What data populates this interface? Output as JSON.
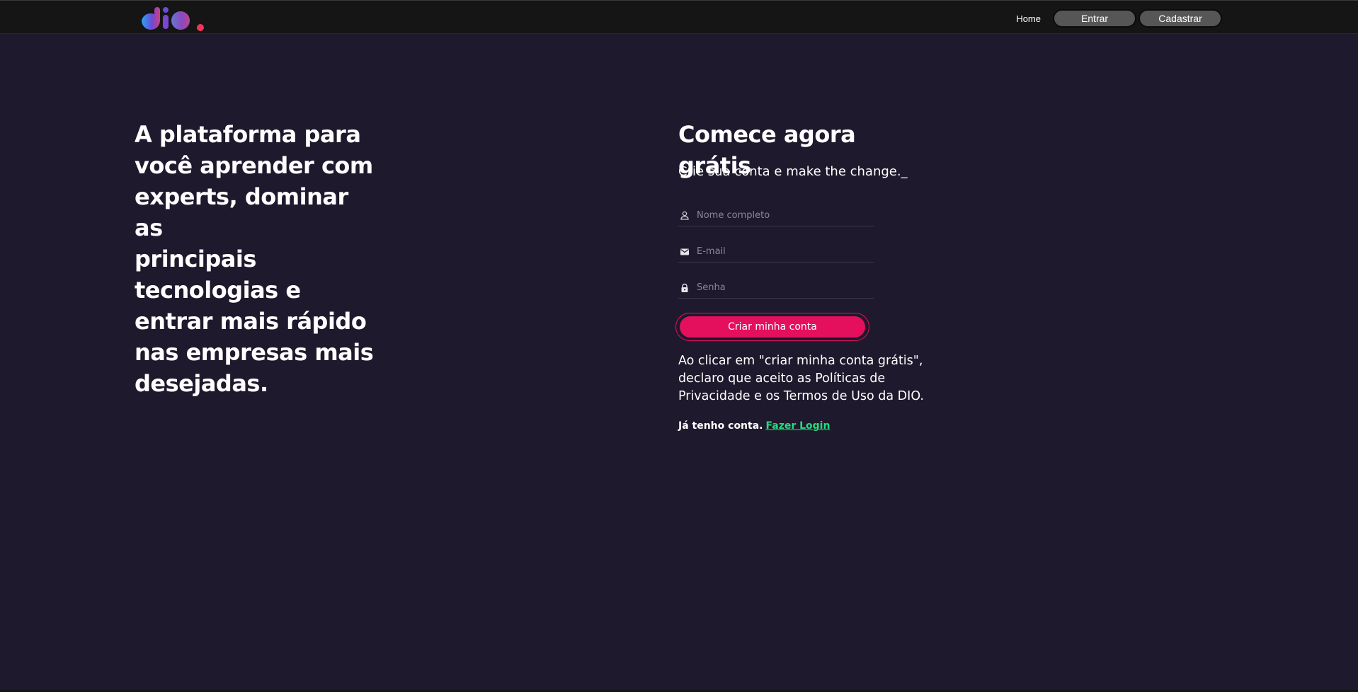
{
  "header": {
    "logo_alt": "dio.",
    "nav": {
      "home_label": "Home",
      "login_label": "Entrar",
      "signup_label": "Cadastrar"
    }
  },
  "hero": {
    "lines": [
      "A plataforma para",
      "você aprender com",
      "experts, dominar as",
      "principais",
      "tecnologias e",
      "entrar mais rápido",
      "nas empresas mais",
      "desejadas."
    ]
  },
  "form": {
    "title": "Comece agora grátis",
    "subtitle": "Crie sua conta e make the change._",
    "fields": {
      "name": {
        "placeholder": "Nome completo",
        "value": "",
        "icon": "person-icon"
      },
      "email": {
        "placeholder": "E-mail",
        "value": "",
        "icon": "mail-icon"
      },
      "password": {
        "placeholder": "Senha",
        "value": "",
        "icon": "lock-icon"
      }
    },
    "submit_label": "Criar minha conta",
    "terms_lines": [
      "Ao clicar em \"criar minha conta grátis\",",
      "declaro que aceito as Políticas de",
      "Privacidade e os Termos de Uso da DIO."
    ],
    "have_account_text": "Já tenho conta.",
    "login_link_label": "Fazer Login"
  },
  "colors": {
    "background": "#1e192c",
    "topbar": "#151515",
    "accent": "#e4105d",
    "link": "#23dd7a",
    "nav_button": "#565656"
  }
}
